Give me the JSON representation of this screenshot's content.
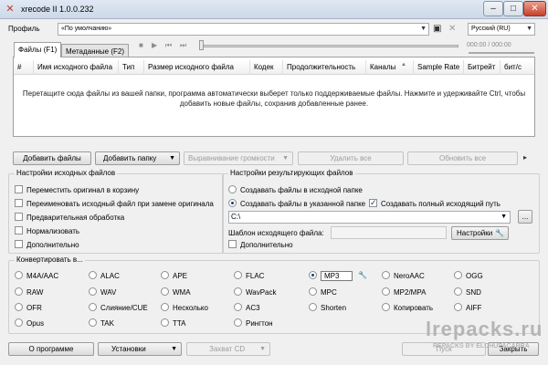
{
  "window": {
    "title": "xrecode II 1.0.0.232",
    "app_icon": "xrecode-icon"
  },
  "profile": {
    "label": "Профиль",
    "value": "«По умолчанию»"
  },
  "language": {
    "value": "Русский (RU)"
  },
  "tabs": [
    {
      "label": "Файлы (F1)"
    },
    {
      "label": "Метаданные (F2)"
    }
  ],
  "player": {
    "time": "000:00 / 000:00"
  },
  "file_table": {
    "columns": [
      "#",
      "Имя исходного файла",
      "Тип",
      "Размер исходного файла",
      "Кодек",
      "Продолжительность",
      "Каналы",
      "Sample Rate",
      "Битрейт",
      "бит/с"
    ],
    "hint": "Перетащите сюда файлы из вашей папки, программа автоматически выберет только поддерживаемые файлы. Нажмите и удерживайте Ctrl, чтобы добавить новые файлы, сохранив добавленные ранее."
  },
  "file_buttons": {
    "add_files": "Добавить файлы",
    "add_folder": "Добавить папку",
    "normalize": "Выравнивание громкости",
    "remove_all": "Удалить все",
    "refresh_all": "Обновить все"
  },
  "source_settings": {
    "title": "Настройки исходных файлов",
    "options": [
      {
        "label": "Переместить оригинал в корзину",
        "checked": false
      },
      {
        "label": "Переименовать исходный файл при замене оригинала",
        "checked": false
      },
      {
        "label": "Предварительная обработка",
        "checked": false
      },
      {
        "label": "Нормализовать",
        "checked": false
      },
      {
        "label": "Дополнительно",
        "checked": false
      }
    ]
  },
  "output_settings": {
    "title": "Настройки результирующих файлов",
    "radio_source_folder": "Создавать файлы в исходной папке",
    "radio_custom_folder": "Создавать файлы в указанной папке",
    "full_path_label": "Создавать полный исходящий путь",
    "path_value": "C:\\",
    "browse_label": "...",
    "template_label": "Шаблон исходящего файла:",
    "settings_button": "Настройки",
    "extra_label": "Дополнительно"
  },
  "convert": {
    "title": "Конвертировать в...",
    "selected": "MP3",
    "formats": [
      [
        "M4A/AAC",
        "ALAC",
        "APE",
        "FLAC",
        "MP3",
        "NeroAAC",
        "OGG"
      ],
      [
        "RAW",
        "WAV",
        "WMA",
        "WavPack",
        "MPC",
        "MP2/MPA",
        "SND"
      ],
      [
        "OFR",
        "Слияние/CUE",
        "Несколько",
        "AC3",
        "Shorten",
        "Копировать",
        "AIFF"
      ],
      [
        "Opus",
        "TAK",
        "TTA",
        "Рингтон"
      ]
    ]
  },
  "bottom": {
    "about": "О программе",
    "settings": "Установки",
    "capture_cd": "Захват CD",
    "start": "Пуск",
    "close": "Закрыть"
  },
  "watermark": {
    "line1": "lrepacks.ru",
    "line2": "REPACKS BY ELCHUPACABRA"
  }
}
